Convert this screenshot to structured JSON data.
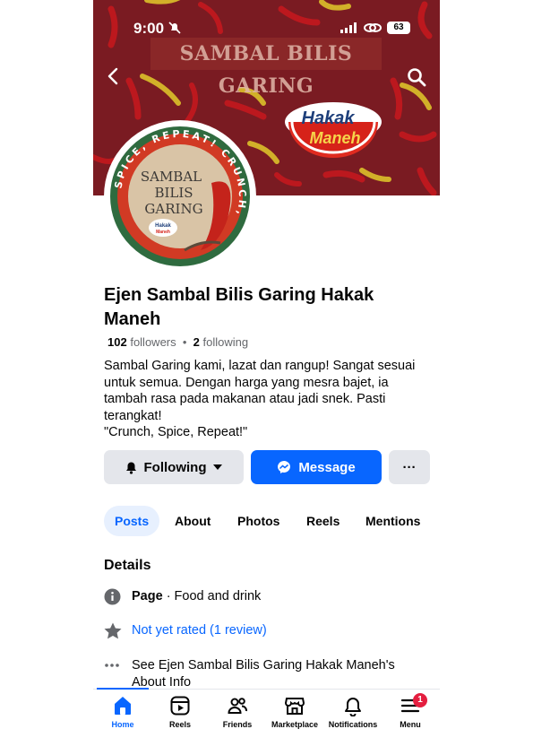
{
  "status_bar": {
    "time": "9:00",
    "battery": "63"
  },
  "cover": {
    "banner_text": "SAMBAL BILIS GARING",
    "logo_word1": "Hakak",
    "logo_word2": "Maneh"
  },
  "avatar": {
    "ring_text": "SPICE, REPEAT! CRUNCH,",
    "brand_line1": "SAMBAL",
    "brand_line2": "BILIS",
    "brand_line3": "GARING",
    "small_logo1": "Hakak",
    "small_logo2": "Maneh"
  },
  "profile": {
    "name": "Ejen Sambal Bilis Garing Hakak Maneh",
    "followers_count": "102",
    "followers_label": "followers",
    "following_count": "2",
    "following_label": "following",
    "bio": "Sambal Garing kami, lazat dan rangup! Sangat sesuai untuk semua. Dengan harga yang mesra bajet, ia tambah rasa pada makanan atau jadi snek. Pasti terangkat!\n\"Crunch, Spice, Repeat!\""
  },
  "actions": {
    "following_label": "Following",
    "message_label": "Message",
    "more_label": "···"
  },
  "tabs": [
    {
      "label": "Posts",
      "active": true
    },
    {
      "label": "About"
    },
    {
      "label": "Photos"
    },
    {
      "label": "Reels"
    },
    {
      "label": "Mentions"
    }
  ],
  "details": {
    "title": "Details",
    "page_label": "Page",
    "page_category": "· Food and drink",
    "rating": "Not yet rated (1 review)",
    "about_link": "See Ejen Sambal Bilis Garing Hakak Maneh's About Info"
  },
  "bottom_nav": [
    {
      "label": "Home",
      "icon": "home-icon",
      "active": true
    },
    {
      "label": "Reels",
      "icon": "reels-icon"
    },
    {
      "label": "Friends",
      "icon": "friends-icon"
    },
    {
      "label": "Marketplace",
      "icon": "marketplace-icon"
    },
    {
      "label": "Notifications",
      "icon": "bell-icon"
    },
    {
      "label": "Menu",
      "icon": "menu-icon",
      "badge": "1"
    }
  ],
  "colors": {
    "accent": "#0866ff",
    "cover": "#7a1b22",
    "badge": "#e41e3f"
  }
}
